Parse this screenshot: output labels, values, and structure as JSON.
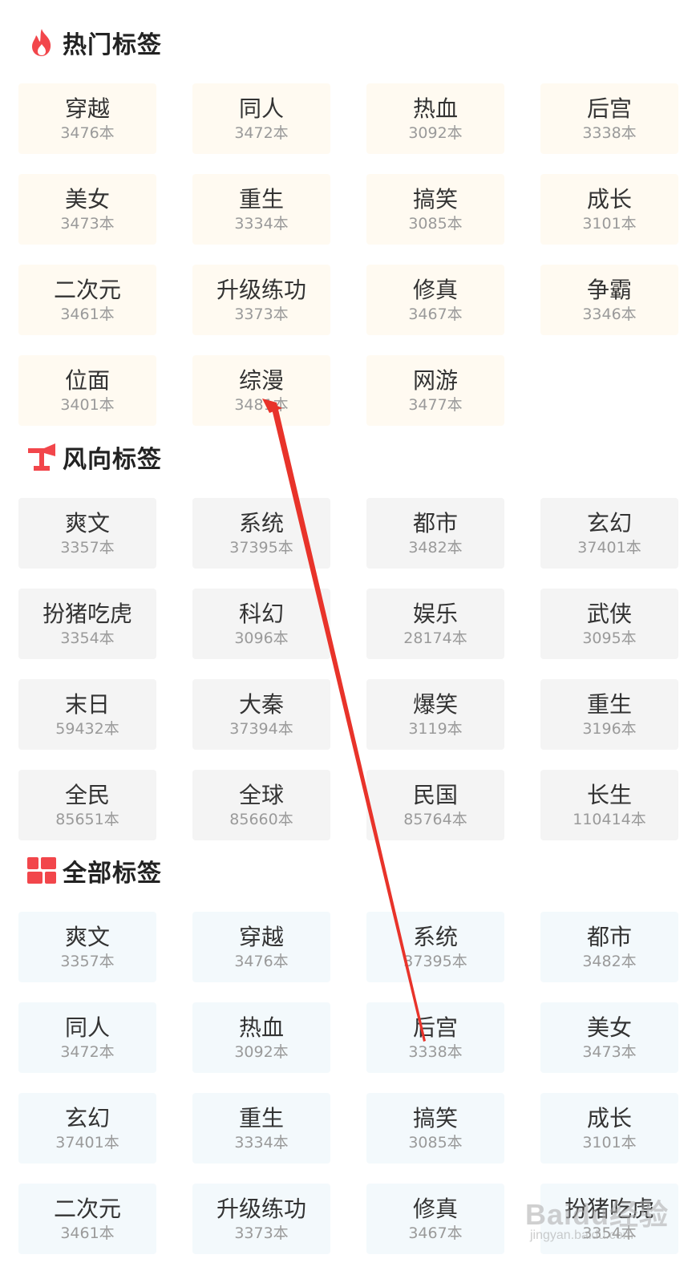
{
  "colors": {
    "accent_red": "#f2464b",
    "hot_tile_bg": "#fffaf1",
    "trend_tile_bg": "#f4f4f4",
    "all_tile_bg": "#f3f9fc",
    "annotation_arrow": "#e8332a"
  },
  "sections": {
    "hot": {
      "title": "热门标签",
      "icon": "flame-icon",
      "tags": [
        {
          "name": "穿越",
          "count": "3476本"
        },
        {
          "name": "同人",
          "count": "3472本"
        },
        {
          "name": "热血",
          "count": "3092本"
        },
        {
          "name": "后宫",
          "count": "3338本"
        },
        {
          "name": "美女",
          "count": "3473本"
        },
        {
          "name": "重生",
          "count": "3334本"
        },
        {
          "name": "搞笑",
          "count": "3085本"
        },
        {
          "name": "成长",
          "count": "3101本"
        },
        {
          "name": "二次元",
          "count": "3461本"
        },
        {
          "name": "升级练功",
          "count": "3373本"
        },
        {
          "name": "修真",
          "count": "3467本"
        },
        {
          "name": "争霸",
          "count": "3346本"
        },
        {
          "name": "位面",
          "count": "3401本"
        },
        {
          "name": "综漫",
          "count": "3481本"
        },
        {
          "name": "网游",
          "count": "3477本"
        }
      ]
    },
    "trend": {
      "title": "风向标签",
      "icon": "weathervane-icon",
      "tags": [
        {
          "name": "爽文",
          "count": "3357本"
        },
        {
          "name": "系统",
          "count": "37395本"
        },
        {
          "name": "都市",
          "count": "3482本"
        },
        {
          "name": "玄幻",
          "count": "37401本"
        },
        {
          "name": "扮猪吃虎",
          "count": "3354本"
        },
        {
          "name": "科幻",
          "count": "3096本"
        },
        {
          "name": "娱乐",
          "count": "28174本"
        },
        {
          "name": "武侠",
          "count": "3095本"
        },
        {
          "name": "末日",
          "count": "59432本"
        },
        {
          "name": "大秦",
          "count": "37394本"
        },
        {
          "name": "爆笑",
          "count": "3119本"
        },
        {
          "name": "重生",
          "count": "3196本"
        },
        {
          "name": "全民",
          "count": "85651本"
        },
        {
          "name": "全球",
          "count": "85660本"
        },
        {
          "name": "民国",
          "count": "85764本"
        },
        {
          "name": "长生",
          "count": "110414本"
        }
      ]
    },
    "all": {
      "title": "全部标签",
      "icon": "grid-blocks-icon",
      "tags": [
        {
          "name": "爽文",
          "count": "3357本"
        },
        {
          "name": "穿越",
          "count": "3476本"
        },
        {
          "name": "系统",
          "count": "37395本"
        },
        {
          "name": "都市",
          "count": "3482本"
        },
        {
          "name": "同人",
          "count": "3472本"
        },
        {
          "name": "热血",
          "count": "3092本"
        },
        {
          "name": "后宫",
          "count": "3338本"
        },
        {
          "name": "美女",
          "count": "3473本"
        },
        {
          "name": "玄幻",
          "count": "37401本"
        },
        {
          "name": "重生",
          "count": "3334本"
        },
        {
          "name": "搞笑",
          "count": "3085本"
        },
        {
          "name": "成长",
          "count": "3101本"
        },
        {
          "name": "二次元",
          "count": "3461本"
        },
        {
          "name": "升级练功",
          "count": "3373本"
        },
        {
          "name": "修真",
          "count": "3467本"
        },
        {
          "name": "扮猪吃虎",
          "count": "3354本"
        }
      ]
    }
  },
  "watermark": {
    "brand": "Baidu经验",
    "url": "jingyan.baidu.com"
  }
}
